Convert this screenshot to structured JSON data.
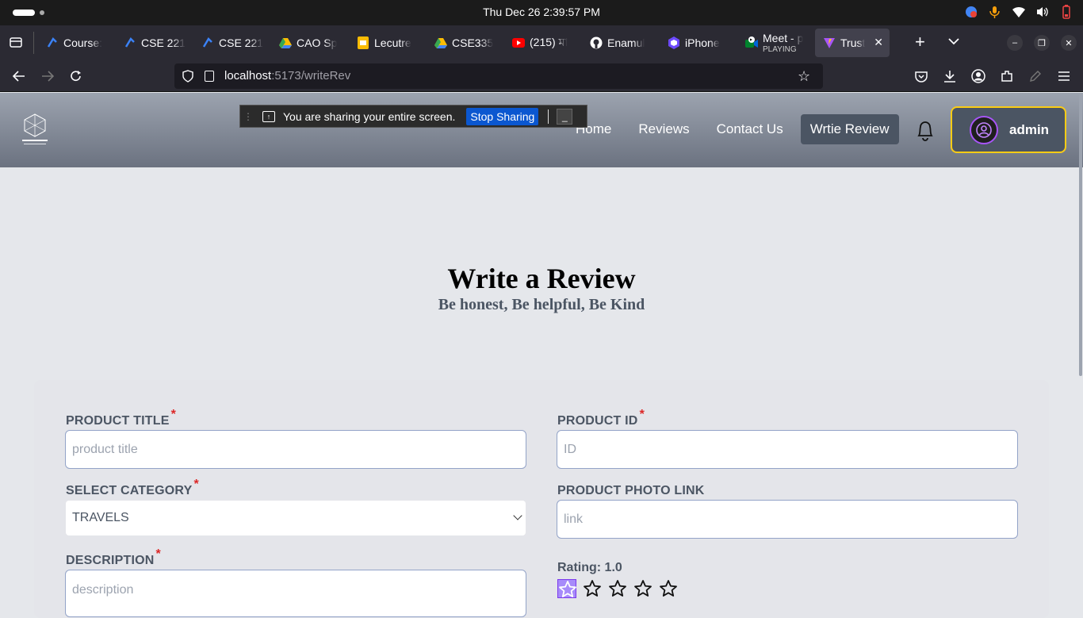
{
  "os": {
    "clock": "Thu Dec 26    2:39:57 PM"
  },
  "browser": {
    "tabs": [
      {
        "title": "Course:",
        "icon": "course-favicon"
      },
      {
        "title": "CSE 221",
        "icon": "course-favicon"
      },
      {
        "title": "CSE 221",
        "icon": "course-favicon"
      },
      {
        "title": "CAO Sp",
        "icon": "google-drive-icon"
      },
      {
        "title": "Lecutre",
        "icon": "google-slides-icon"
      },
      {
        "title": "CSE335",
        "icon": "google-drive-icon"
      },
      {
        "title": "(215) মা",
        "icon": "youtube-icon"
      },
      {
        "title": "Enamul",
        "icon": "github-icon"
      },
      {
        "title": "iPhone",
        "icon": "proton-icon"
      },
      {
        "title": "Meet - p",
        "subtitle": "PLAYING",
        "icon": "google-meet-icon"
      },
      {
        "title": "Trust",
        "icon": "vite-icon",
        "active": true
      }
    ],
    "url_host": "localhost",
    "url_rest": ":5173/writeRev"
  },
  "share_bar": {
    "message": "You are sharing your entire screen.",
    "stop_label": "Stop Sharing",
    "minimize_label": "_"
  },
  "app": {
    "nav": [
      "Home",
      "Reviews",
      "Contact Us",
      "Wrtie Review"
    ],
    "active_nav": "Wrtie Review",
    "user": "admin"
  },
  "hero": {
    "title": "Write a Review",
    "subtitle": "Be honest, Be helpful, Be Kind"
  },
  "form": {
    "product_title_label": "PRODUCT TITLE",
    "product_title_placeholder": "product title",
    "product_id_label": "PRODUCT ID",
    "product_id_placeholder": "ID",
    "category_label": "SELECT CATEGORY",
    "category_value": "TRAVELS",
    "photo_label": "PRODUCT PHOTO LINK",
    "photo_placeholder": "link",
    "description_label": "DESCRIPTION",
    "description_placeholder": "description",
    "required_mark": "*",
    "rating_label": "Rating: 1.0",
    "rating_value": 1,
    "rating_max": 5
  },
  "colors": {
    "accent": "#a855f7",
    "admin_border": "#facc15",
    "required": "#dc2626"
  }
}
